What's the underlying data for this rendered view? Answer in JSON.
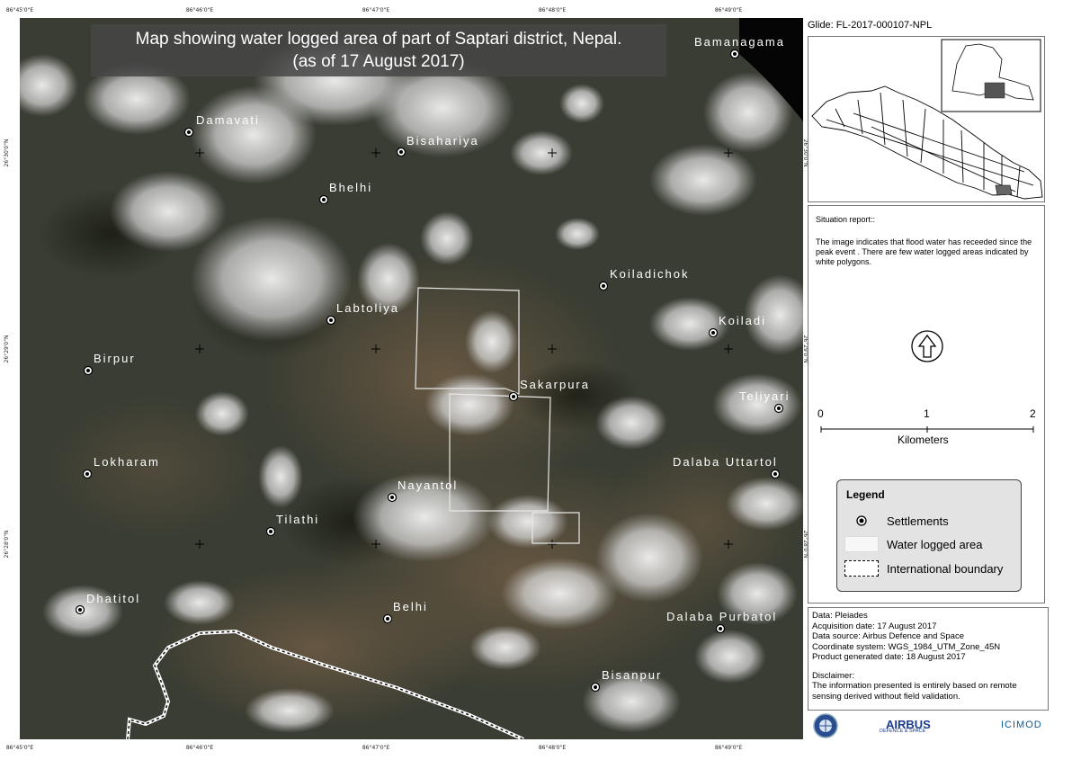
{
  "map": {
    "title_line1": "Map showing water logged area of part of Saptari district, Nepal.",
    "title_line2": "(as of 17 August 2017)",
    "settlements": [
      {
        "name": "Bamanagama"
      },
      {
        "name": "Damavati"
      },
      {
        "name": "Bisahariya"
      },
      {
        "name": "Bhelhi"
      },
      {
        "name": "Koiladichok"
      },
      {
        "name": "Labtoliya"
      },
      {
        "name": "Koiladi"
      },
      {
        "name": "Birpur"
      },
      {
        "name": "Sakarpura"
      },
      {
        "name": "Teliyari"
      },
      {
        "name": "Lokharam"
      },
      {
        "name": "Dalaba Uttartol"
      },
      {
        "name": "Nayantol"
      },
      {
        "name": "Tilathi"
      },
      {
        "name": "Dhatitol"
      },
      {
        "name": "Belhi"
      },
      {
        "name": "Dalaba Purbatol"
      },
      {
        "name": "Bisanpur"
      }
    ],
    "coords_top": [
      "86°45'0\"E",
      "86°46'0\"E",
      "86°47'0\"E",
      "86°48'0\"E",
      "86°49'0\"E"
    ],
    "coords_bottom": [
      "86°45'0\"E",
      "86°46'0\"E",
      "86°47'0\"E",
      "86°48'0\"E",
      "86°49'0\"E"
    ],
    "coords_left": [
      "26°30'0\"N",
      "26°29'0\"N",
      "26°28'0\"N"
    ],
    "coords_right": [
      "26°30'0\"N",
      "26°29'0\"N",
      "26°28'0\"N"
    ]
  },
  "sidebar": {
    "glide": "Glide: FL-2017-000107-NPL",
    "situation_heading": "Situation report::",
    "situation_text": "The image indicates that flood water has receeded since the peak event . There are few water logged areas indicated by white polygons.",
    "scale": {
      "ticks": [
        "0",
        "1",
        "2"
      ],
      "unit": "Kilometers"
    },
    "legend": {
      "title": "Legend",
      "items": [
        "Settlements",
        "Water logged area",
        "International boundary"
      ]
    },
    "info": {
      "data": "Data: Pleiades",
      "acquisition": "Acquisition date: 17 August 2017",
      "source": "Data source: Airbus Defence and Space",
      "coord_system": "Coordinate system: WGS_1984_UTM_Zone_45N",
      "generated": "Product generated date: 18 August 2017",
      "disclaimer_heading": "Disclaimer:",
      "disclaimer_text": "The information presented is entirely based on remote sensing derived without field validation."
    },
    "logos": {
      "airbus": "AIRBUS",
      "airbus_sub": "DEFENCE & SPACE",
      "icimod": "ICIMOD"
    }
  },
  "colors": {
    "water_polygon": "#e8e8e8",
    "map_base": "#3a3d33",
    "title_bg": "#464646"
  }
}
